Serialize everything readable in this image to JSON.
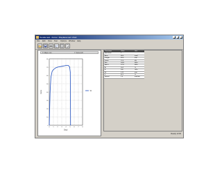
{
  "window": {
    "title": "Tensile test - Force / Displacement chart"
  },
  "menu": {
    "items": [
      "File",
      "Edit",
      "View",
      "Test",
      "Options",
      "Window",
      "Help"
    ]
  },
  "toolbar": {
    "buttons": [
      "open-icon",
      "save-icon",
      "print-icon",
      "chart-icon",
      "table-icon",
      "print-preview-icon"
    ]
  },
  "chart_panel": {
    "header_left": "X: Displ. mm",
    "header_right": "Y: Force kN"
  },
  "chart_data": {
    "type": "line",
    "title": "",
    "xlabel": "Displ.",
    "ylabel": "Force",
    "xlim": [
      0,
      8
    ],
    "ylim": [
      0,
      80
    ],
    "xticks": [
      "0",
      "1",
      "2",
      "3",
      "4",
      "5",
      "6",
      "7",
      "8"
    ],
    "yticks": [
      "0",
      "10",
      "20",
      "30",
      "40",
      "50",
      "60",
      "70",
      "80"
    ],
    "grid": true,
    "legend_position": "right",
    "series": [
      {
        "name": "S1",
        "color": "#1f4fc0",
        "x": [
          0.0,
          0.2,
          0.4,
          0.7,
          1.0,
          1.5,
          2.0,
          3.0,
          4.0,
          4.6,
          4.9,
          5.05,
          5.1,
          5.12
        ],
        "y": [
          0,
          40,
          58,
          65,
          67,
          69,
          70,
          71,
          72,
          72,
          70,
          64,
          30,
          0
        ]
      }
    ]
  },
  "table": {
    "headers": [
      "Parameter",
      "Value",
      "Unit"
    ],
    "rows": [
      [
        "Specimen",
        "1",
        ""
      ],
      [
        "Area",
        "38.5",
        "mm2"
      ],
      [
        "Length",
        "50.0",
        "mm"
      ],
      [
        "Fmax",
        "72.3",
        "kN"
      ],
      [
        "Rm",
        "1878",
        "MPa"
      ],
      [
        "Rp0.2",
        "1712",
        "MPa"
      ],
      [
        "A",
        "10.2",
        "%"
      ],
      [
        "E",
        "205",
        "GPa"
      ],
      [
        "dL",
        "5.12",
        "mm"
      ],
      [
        "Z",
        "42.1",
        "%"
      ],
      [
        "Speed",
        "2.0",
        "mm/min"
      ]
    ]
  },
  "status": {
    "text": "Ready  12:00"
  }
}
